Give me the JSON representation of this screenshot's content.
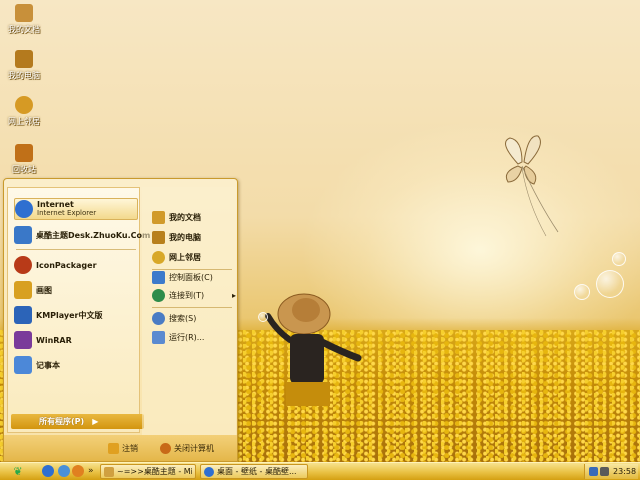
{
  "desktop": {
    "icons": [
      {
        "label": "我的文档",
        "icon": "folder-documents-icon",
        "color": "#c8903a"
      },
      {
        "label": "我的电脑",
        "icon": "computer-icon",
        "color": "#b47a1e"
      },
      {
        "label": "网上邻居",
        "icon": "network-icon",
        "color": "#d69a24"
      },
      {
        "label": "回收站",
        "icon": "recycle-bin-icon",
        "color": "#c07018"
      }
    ]
  },
  "start_menu": {
    "pinned": [
      {
        "title": "Internet",
        "subtitle": "Internet Explorer",
        "icon": "internet-explorer-icon",
        "color": "#2f6fd0"
      },
      {
        "title": "桌酷主题Desk.ZhuoKu.Com",
        "icon": "zhuoku-theme-icon",
        "color": "#3a78c8"
      }
    ],
    "recent": [
      {
        "title": "IconPackager",
        "icon": "iconpackager-icon",
        "color": "#b83a18"
      },
      {
        "title": "画图",
        "icon": "paint-icon",
        "color": "#d8a020"
      },
      {
        "title": "KMPlayer中文版",
        "icon": "kmplayer-icon",
        "color": "#2c64b8"
      },
      {
        "title": "WinRAR",
        "icon": "winrar-icon",
        "color": "#7a3a9a"
      },
      {
        "title": "记事本",
        "icon": "notepad-icon",
        "color": "#4c88d8"
      }
    ],
    "all_programs": "所有程序(P)",
    "all_programs_arrow": "▶",
    "places": [
      {
        "label": "我的文档",
        "icon": "my-documents-icon",
        "bold": true,
        "color": "#d19a2a"
      },
      {
        "label": "我的电脑",
        "icon": "my-computer-icon",
        "bold": true,
        "color": "#b8801c"
      },
      {
        "label": "网上邻居",
        "icon": "my-network-icon",
        "bold": true,
        "color": "#d8a828"
      }
    ],
    "system": [
      {
        "label": "控制面板(C)",
        "icon": "control-panel-icon",
        "color": "#3c7acb"
      },
      {
        "label": "连接到(T)",
        "icon": "connect-to-icon",
        "color": "#2e8c4a",
        "submenu": "▸"
      }
    ],
    "tools": [
      {
        "label": "搜索(S)",
        "icon": "search-icon",
        "color": "#4a7cc4"
      },
      {
        "label": "运行(R)...",
        "icon": "run-icon",
        "color": "#5a8ad0"
      }
    ],
    "footer": [
      {
        "label": "注销",
        "icon": "logoff-icon"
      },
      {
        "label": "关闭计算机",
        "icon": "shutdown-icon"
      }
    ]
  },
  "taskbar": {
    "start_glyph": "❦",
    "quick_launch": [
      {
        "icon": "ie-quicklaunch-icon",
        "color": "#2f6fd0"
      },
      {
        "icon": "show-desktop-icon",
        "color": "#4a90d8"
      },
      {
        "icon": "media-player-icon",
        "color": "#e08020"
      }
    ],
    "overflow": "»",
    "tasks": [
      {
        "label": "~=>>桌酷主题 - Mic...",
        "icon": "folder-window-icon",
        "color": "#d0a040"
      },
      {
        "label": "桌面 - 壁纸 - 桌酷壁...",
        "icon": "ie-window-icon",
        "color": "#2f6fd0"
      }
    ],
    "clock": "23:58"
  }
}
